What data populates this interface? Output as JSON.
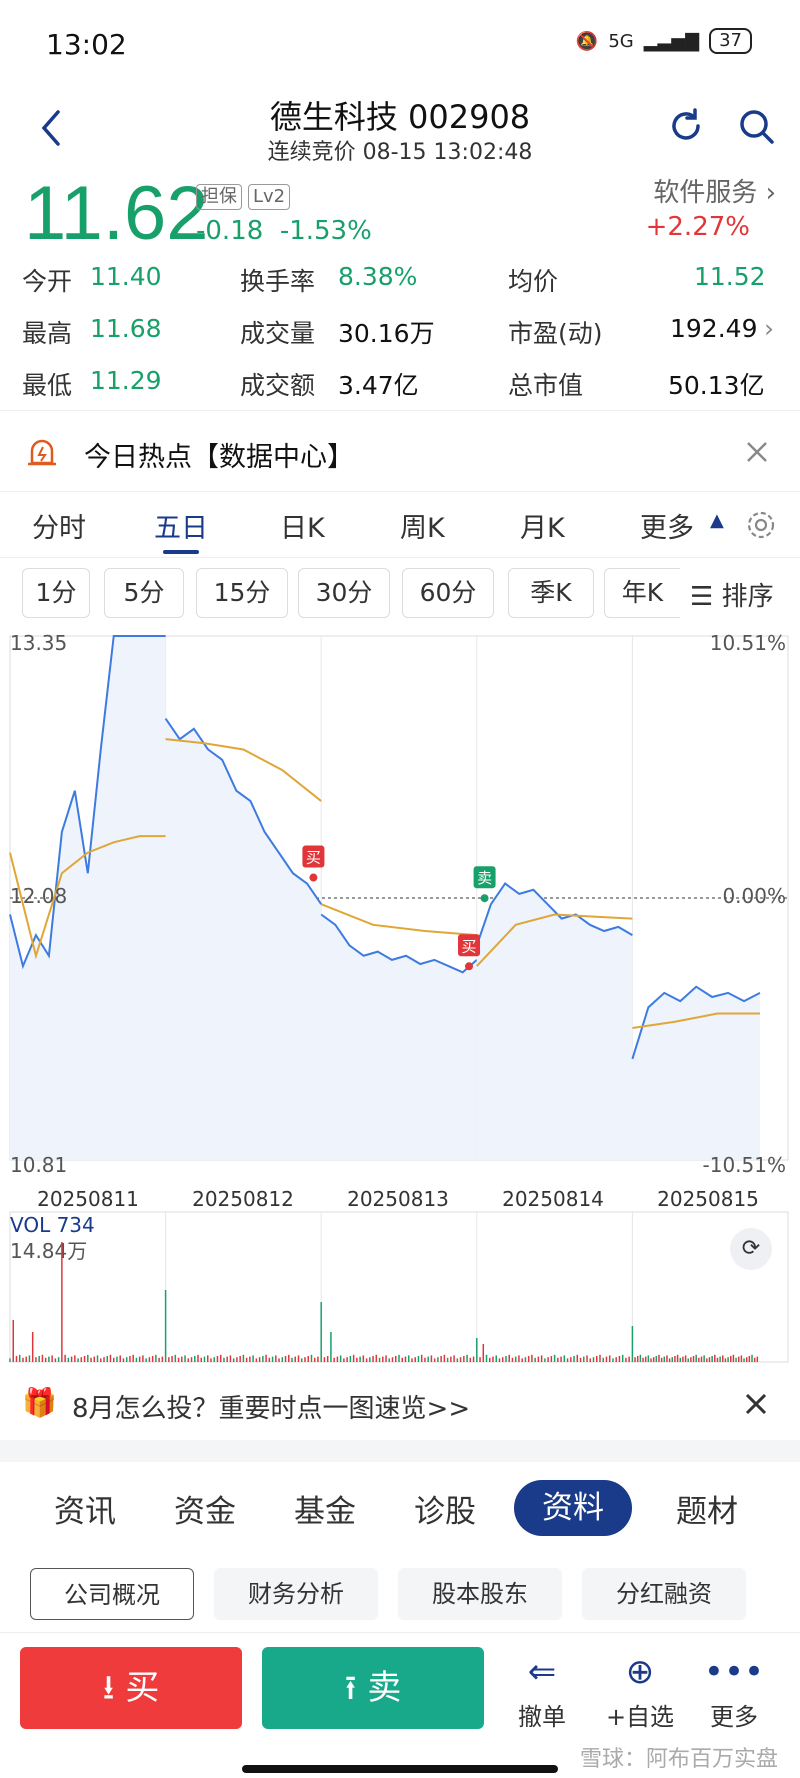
{
  "status": {
    "time": "13:02",
    "network": "5G",
    "battery": "37"
  },
  "header": {
    "title": "德生科技 002908",
    "subtitle": "连续竞价 08-15 13:02:48"
  },
  "quote": {
    "price": "11.62",
    "tags": [
      "担保",
      "Lv2"
    ],
    "change": "-0.18",
    "change_pct": "-1.53%",
    "sector": "软件服务",
    "sector_pct": "+2.27%",
    "stats": [
      [
        {
          "label": "今开",
          "value": "11.40"
        },
        {
          "label": "换手率",
          "value": "8.38%"
        },
        {
          "label": "均价",
          "value": "11.52"
        }
      ],
      [
        {
          "label": "最高",
          "value": "11.68"
        },
        {
          "label": "成交量",
          "value": "30.16万"
        },
        {
          "label": "市盈(动)",
          "value": "192.49"
        }
      ],
      [
        {
          "label": "最低",
          "value": "11.29"
        },
        {
          "label": "成交额",
          "value": "3.47亿"
        },
        {
          "label": "总市值",
          "value": "50.13亿"
        }
      ]
    ]
  },
  "hot_banner": {
    "text": "今日热点【数据中心】"
  },
  "chart_tabs": [
    "分时",
    "五日",
    "日K",
    "周K",
    "月K",
    "更多"
  ],
  "periods": [
    "1分",
    "5分",
    "15分",
    "30分",
    "60分",
    "季K",
    "年K"
  ],
  "sort_label": "排序",
  "chart_data": {
    "type": "line",
    "y_max_label": "13.35",
    "y_min_label": "10.81",
    "y_mid_label": "12.08",
    "pct_max_label": "10.51%",
    "pct_min_label": "-10.51%",
    "pct_mid_label": "0.00%",
    "ylim": [
      10.81,
      13.35
    ],
    "dates": [
      "20250811",
      "20250812",
      "20250813",
      "20250814",
      "20250815"
    ],
    "price_series": [
      [
        12.0,
        11.75,
        11.9,
        11.8,
        12.4,
        12.6,
        12.2,
        12.8,
        13.35,
        13.35,
        13.35,
        13.35,
        13.35
      ],
      [
        12.95,
        12.85,
        12.9,
        12.8,
        12.75,
        12.6,
        12.55,
        12.4,
        12.3,
        12.2,
        12.15,
        12.05
      ],
      [
        12.0,
        11.95,
        11.85,
        11.8,
        11.82,
        11.78,
        11.8,
        11.76,
        11.78,
        11.75,
        11.72,
        11.78
      ],
      [
        11.85,
        12.05,
        12.15,
        12.1,
        12.12,
        12.05,
        11.98,
        12.0,
        11.95,
        11.92,
        11.94,
        11.9
      ],
      [
        11.3,
        11.55,
        11.62,
        11.58,
        11.65,
        11.6,
        11.62,
        11.58,
        11.62
      ]
    ],
    "avg_series": [
      [
        12.3,
        11.8,
        12.2,
        12.3,
        12.35,
        12.38,
        12.38
      ],
      [
        12.85,
        12.83,
        12.8,
        12.7,
        12.55
      ],
      [
        12.05,
        11.95,
        11.92,
        11.9
      ],
      [
        11.75,
        11.95,
        12.0,
        11.99,
        11.98
      ],
      [
        11.45,
        11.48,
        11.52,
        11.52
      ]
    ],
    "volume_label": "VOL 734",
    "volume_max_label": "14.84万",
    "markers": [
      {
        "label": "买",
        "day": 1,
        "pos": 0.95
      },
      {
        "label": "买",
        "day": 2,
        "pos": 0.95
      },
      {
        "label": "卖",
        "day": 3,
        "pos": 0.05
      }
    ]
  },
  "promo": {
    "text": "8月怎么投？重要时点一图速览>>"
  },
  "bottom_tabs": [
    "资讯",
    "资金",
    "基金",
    "诊股",
    "资料",
    "题材"
  ],
  "sub_tabs": [
    "公司概况",
    "财务分析",
    "股本股东",
    "分红融资"
  ],
  "actions": {
    "buy": "买",
    "sell": "卖",
    "cancel": "撤单",
    "watch": "+自选",
    "more": "更多"
  },
  "watermark": "雪球：阿布百万实盘",
  "colors": {
    "down": "#18a06b",
    "up": "#e0363a",
    "brand": "#1a3a8a",
    "line": "#3d7be0",
    "avg": "#e0a636"
  }
}
